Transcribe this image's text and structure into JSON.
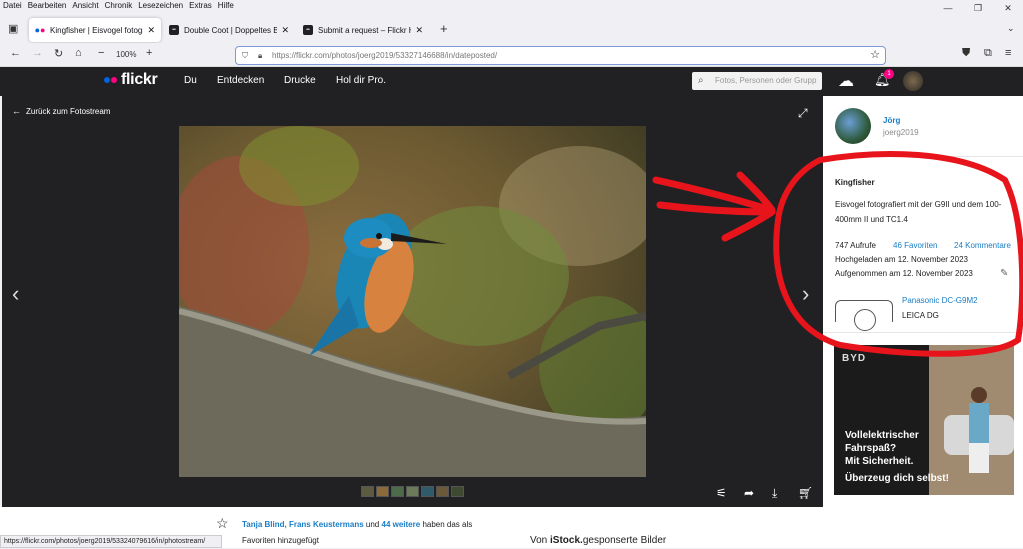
{
  "menubar": [
    "Datei",
    "Bearbeiten",
    "Ansicht",
    "Chronik",
    "Lesezeichen",
    "Extras",
    "Hilfe"
  ],
  "tabs": [
    {
      "title": "Kingfisher | Eisvogel fotografie",
      "active": true
    },
    {
      "title": "Double Coot | Doppeltes Blässh",
      "active": false
    },
    {
      "title": "Submit a request – Flickr Help C",
      "active": false
    }
  ],
  "nav": {
    "zoom": "100%",
    "url_host": "https://flickr.com",
    "url_path": "/photos/joerg2019/53327146688/in/dateposted/"
  },
  "header": {
    "logo": "flickr",
    "items": [
      "Du",
      "Entdecken",
      "Drucke",
      "Hol dir Pro."
    ],
    "search_placeholder": "Fotos, Personen oder Grupp",
    "notification_count": "1"
  },
  "viewer": {
    "back_label": "Zurück zum Fotostream"
  },
  "sidebar": {
    "user_name": "Jörg",
    "user_handle": "joerg2019",
    "photo_title": "Kingfisher",
    "description": "Eisvogel fotografiert mit der G9II und dem 100-400mm II und TC1.4",
    "views": "747 Aufrufe",
    "favorites": "46 Favoriten",
    "comments": "24 Kommentare",
    "uploaded": "Hochgeladen am 12. November 2023",
    "taken": "Aufgenommen am 12. November 2023",
    "camera": "Panasonic DC-G9M2",
    "lens": "LEICA DG"
  },
  "ad": {
    "brand": "BYD",
    "headline_1": "Vollelektrischer",
    "headline_2": "Fahrspaß?",
    "headline_3": "Mit Sicherheit.",
    "cta": "Überzeug dich selbst!"
  },
  "favs": {
    "names": "Tanja Blind, Frans Keustermans",
    "and": "und",
    "more": "44 weitere",
    "suffix": "haben das als",
    "line2": "Favoriten hinzugefügt"
  },
  "status_url": "https://flickr.com/photos/joerg2019/53324079616/in/photostream/",
  "sponsor": {
    "prefix": "Von",
    "brand": "iStock.",
    "suffix": "gesponserte Bilder"
  },
  "colors": {
    "flickr_blue": "#0063dc",
    "flickr_pink": "#ff0084",
    "link": "#1a7dc6",
    "annotation_red": "#e8141b"
  }
}
